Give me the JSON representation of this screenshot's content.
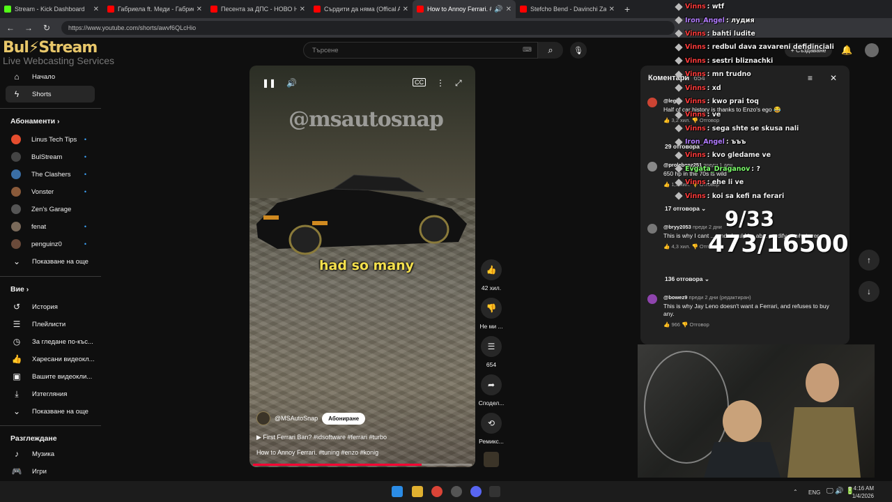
{
  "browser": {
    "tabs": [
      {
        "title": "Stream - Kick Dashboard",
        "color": "#53fc18"
      },
      {
        "title": "Габриела ft. Меди - Габриела",
        "color": "#ff0000"
      },
      {
        "title": "Песента за ДПС - НОВО НАЧА",
        "color": "#ff0000"
      },
      {
        "title": "Сърдити да няма (Offical AI Ar",
        "color": "#ff0000"
      },
      {
        "title": "How to Annoy Ferrari. #tu",
        "color": "#ff0000"
      },
      {
        "title": "Stefcho Bend - Davinchi Zakon",
        "color": "#ff0000"
      }
    ],
    "url": "https://www.youtube.com/shorts/awvf6QLcHio"
  },
  "overlay": {
    "brand": "Bul⚡Stream",
    "tagline": "Live Webcasting Services",
    "yt": "YouTube"
  },
  "youtube": {
    "search_placeholder": "Търсене",
    "create_label": "+ Създаване",
    "sidebar": {
      "home": "Начало",
      "shorts": "Shorts",
      "subs_heading": "Абонаменти",
      "subs": [
        {
          "name": "Linus Tech Tips",
          "color": "#e54d2e"
        },
        {
          "name": "BulStream",
          "color": "#444"
        },
        {
          "name": "The Clashers",
          "color": "#3a6ea5"
        },
        {
          "name": "Vonster",
          "color": "#8a5a3a"
        },
        {
          "name": "Zen's Garage",
          "color": "#555"
        },
        {
          "name": "fenat",
          "color": "#7a6a5a"
        },
        {
          "name": "penguinz0",
          "color": "#6a4a3a"
        }
      ],
      "show_more": "Показване на още",
      "you_heading": "Вие",
      "you_items": [
        "История",
        "Плейлисти",
        "За гледане по-къс...",
        "Харесани видеокл...",
        "Вашите видеокли...",
        "Изтегляния",
        "Показване на още"
      ],
      "explore_heading": "Разглеждане",
      "explore_items": [
        "Музика",
        "Игри"
      ]
    },
    "video": {
      "watermark": "@msautosnap",
      "caption": "had so many",
      "channel": "@MSAutoSnap",
      "subscribe": "Абониране",
      "playlist_line": "▶  First Ferrari Ban? #idsoftware #ferrari #turbo",
      "title": "How to Annoy Ferrari. #tuning #enzo #konig",
      "progress": 0.77
    },
    "actions": {
      "likes": "42 хил.",
      "dislike": "Не ми ...",
      "comments": "654",
      "share": "Сподел...",
      "remix": "Ремикс..."
    },
    "comments_panel": {
      "title": "Коментари",
      "count": "654",
      "items": [
        {
          "user": "@legi...",
          "meta": "",
          "text": "Half of car history is thanks to Enzo's ego 😂",
          "likes": "3,2 хил.",
          "reply": "Отговор",
          "replies": "29 отговора"
        },
        {
          "user": "@prolebenz251",
          "meta": "преди 1 ден",
          "text": "650 hp in the 70s is wild",
          "likes": "1,3 хил.",
          "reply": "Отговор",
          "replies": "17 отговора"
        },
        {
          "user": "@bryy2053",
          "meta": "преди 2 дни",
          "text": "This is why I cant ... and should be ab... modify ... whatever ...",
          "likes": "4,3 хил.",
          "reply": "Отговор",
          "replies": "136 отговора"
        },
        {
          "user": "@bowez9",
          "meta": "преди 2 дни (редактиран)",
          "text": "This is why Jay Leno doesn't want a Ferrari, and refuses to buy any.",
          "likes": "966",
          "reply": "Отговор",
          "replies": ""
        }
      ]
    }
  },
  "stream_chat": [
    {
      "user": "Vinns",
      "text": ": wtf",
      "color": "#ff3b3b"
    },
    {
      "user": "Iron_Angel",
      "text": ": лудия",
      "color": "#b27cff"
    },
    {
      "user": "Vinns",
      "text": ": bahti ludite",
      "color": "#ff3b3b"
    },
    {
      "user": "Vinns",
      "text": ": redbul dava zavareni defidinciali",
      "color": "#ff3b3b"
    },
    {
      "user": "Vinns",
      "text": ": sestri bliznachki",
      "color": "#ff3b3b"
    },
    {
      "user": "Vinns",
      "text": ": mn trudno",
      "color": "#ff3b3b"
    },
    {
      "user": "Vinns",
      "text": ": xd",
      "color": "#ff3b3b"
    },
    {
      "user": "Vinns",
      "text": ": kwo prai toq",
      "color": "#ff3b3b"
    },
    {
      "user": "Vinns",
      "text": ": ve",
      "color": "#ff3b3b"
    },
    {
      "user": "Vinns",
      "text": ": sega shte se skusa nali",
      "color": "#ff3b3b"
    },
    {
      "user": "Iron_Angel",
      "text": ": ъъъ",
      "color": "#b27cff"
    },
    {
      "user": "Vinns",
      "text": ": kvo gledame ve",
      "color": "#ff3b3b"
    },
    {
      "user": "Evgata_Draganov",
      "text": ": ?",
      "color": "#7cff6b"
    },
    {
      "user": "Vinns",
      "text": ": ehe li ve",
      "color": "#ff3b3b"
    },
    {
      "user": "Vinns",
      "text": ": koi sa kefi na ferari",
      "color": "#ff3b3b"
    }
  ],
  "counter": {
    "line1": "9/33",
    "line2": "473/16500"
  },
  "tray": {
    "lang": "ENG",
    "time": "4:16 AM",
    "date": "1/4/2026"
  }
}
